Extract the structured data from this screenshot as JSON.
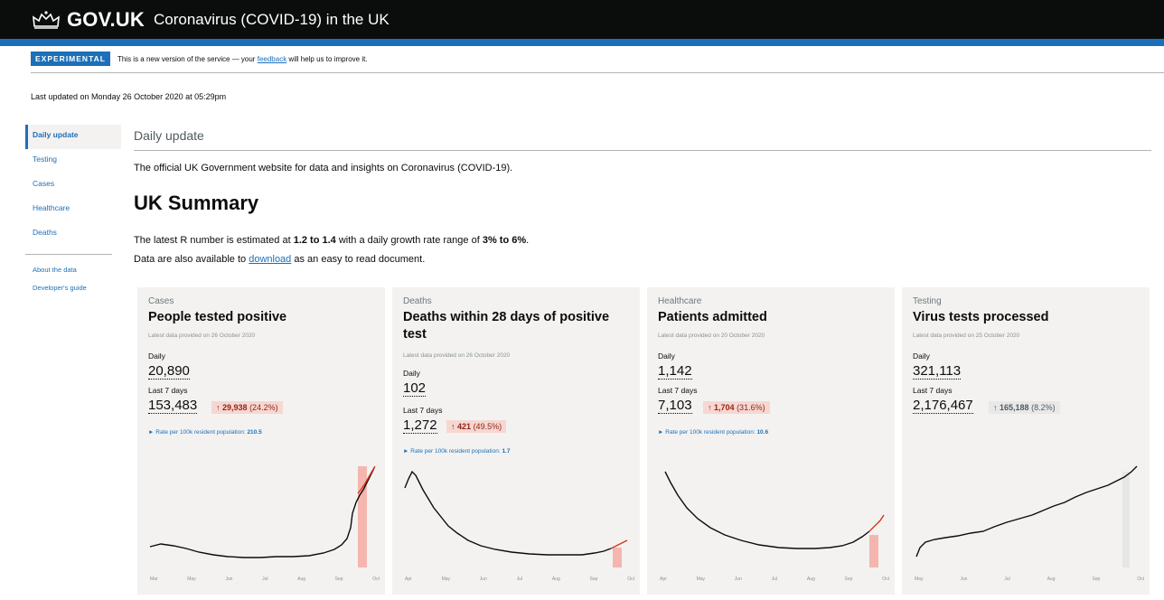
{
  "header": {
    "logo": "GOV.UK",
    "service": "Coronavirus (COVID-19) in the UK"
  },
  "phase": {
    "tag": "EXPERIMENTAL",
    "text_before": "This is a new version of the service — your",
    "link": "feedback",
    "text_after": "will help us to improve it."
  },
  "last_updated": "Last updated on Monday 26 October 2020 at 05:29pm",
  "sidenav": {
    "items": [
      "Daily update",
      "Testing",
      "Cases",
      "Healthcare",
      "Deaths"
    ],
    "secondary": [
      "About the data",
      "Developer's guide"
    ]
  },
  "page": {
    "heading": "Daily update",
    "intro": "The official UK Government website for data and insights on Coronavirus (COVID-19).",
    "summary_title": "UK Summary",
    "r_before": "The latest R number is estimated at",
    "r_value": "1.2 to 1.4",
    "r_middle": "with a daily growth rate range of",
    "growth": "3% to 6%",
    "r_end": ".",
    "download_before": "Data are also available to",
    "download_link": "download",
    "download_after": "as an easy to read document."
  },
  "cards": [
    {
      "category": "Cases",
      "title": "People tested positive",
      "provided": "Latest data provided on 26 October 2020",
      "daily_label": "Daily",
      "daily": "20,890",
      "last7_label": "Last 7 days",
      "last7": "153,483",
      "change": "29,938",
      "change_pct": "(24.2%)",
      "rate_label": "Rate per 100k resident population:",
      "rate": "210.5",
      "months": [
        "Mar",
        "May",
        "Jun",
        "Jul",
        "Aug",
        "Sep",
        "Oct"
      ]
    },
    {
      "category": "Deaths",
      "title": "Deaths within 28 days of positive test",
      "provided": "Latest data provided on 26 October 2020",
      "daily_label": "Daily",
      "daily": "102",
      "last7_label": "Last 7 days",
      "last7": "1,272",
      "change": "421",
      "change_pct": "(49.5%)",
      "rate_label": "Rate per 100k resident population:",
      "rate": "1.7",
      "months": [
        "Apr",
        "May",
        "Jun",
        "Jul",
        "Aug",
        "Sep",
        "Oct"
      ]
    },
    {
      "category": "Healthcare",
      "title": "Patients admitted",
      "provided": "Latest data provided on 20 October 2020",
      "daily_label": "Daily",
      "daily": "1,142",
      "last7_label": "Last 7 days",
      "last7": "7,103",
      "change": "1,704",
      "change_pct": "(31.6%)",
      "rate_label": "Rate per 100k resident population:",
      "rate": "10.6",
      "months": [
        "Apr",
        "May",
        "Jun",
        "Jul",
        "Aug",
        "Sep",
        "Oct"
      ]
    },
    {
      "category": "Testing",
      "title": "Virus tests processed",
      "provided": "Latest data provided on 25 October 2020",
      "daily_label": "Daily",
      "daily": "321,113",
      "last7_label": "Last 7 days",
      "last7": "2,176,467",
      "change": "165,188",
      "change_pct": "(8.2%)",
      "months": [
        "May",
        "Jun",
        "Jul",
        "Aug",
        "Sep",
        "Oct"
      ]
    }
  ],
  "colors": {
    "header": "#0b0c0c",
    "blue": "#1d70b8",
    "up_bg": "#f6d7d2",
    "up_text": "#942514",
    "card_bg": "#f3f2f1",
    "highlight": "#f4b6ae"
  }
}
